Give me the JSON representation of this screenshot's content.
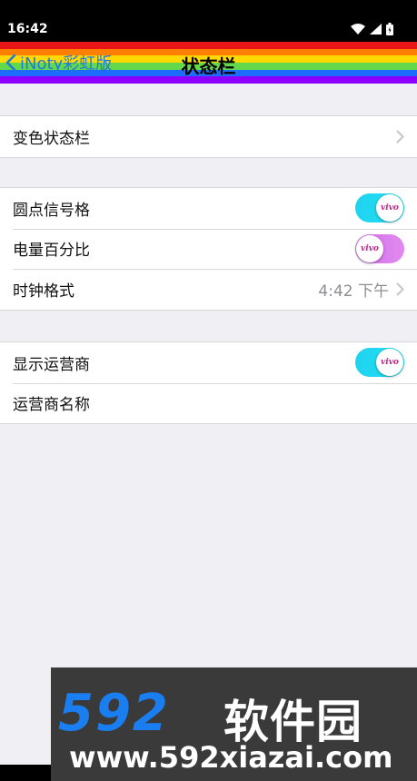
{
  "status_bar": {
    "time": "16:42",
    "icons": [
      "wifi-icon",
      "signal-icon",
      "battery-icon"
    ]
  },
  "nav": {
    "back_label": "iNoty彩虹版",
    "title": "状态栏",
    "rainbow_colors": [
      "#e81416",
      "#ff7f00",
      "#ffd800",
      "#63d84b",
      "#1e6bff",
      "#8b00ff"
    ]
  },
  "groups": [
    {
      "rows": [
        {
          "label": "变色状态栏",
          "type": "chevron"
        }
      ]
    },
    {
      "rows": [
        {
          "label": "圆点信号格",
          "type": "toggle",
          "on": true,
          "knob_text": "vivo"
        },
        {
          "label": "电量百分比",
          "type": "toggle",
          "on": false,
          "knob_text": "vivo"
        },
        {
          "label": "时钟格式",
          "type": "value-chevron",
          "value": "4:42 下午"
        }
      ]
    },
    {
      "rows": [
        {
          "label": "显示运营商",
          "type": "toggle",
          "on": true,
          "knob_text": "vivo"
        },
        {
          "label": "运营商名称",
          "type": "plain"
        }
      ]
    }
  ],
  "watermark": {
    "number": "592",
    "brand": "软件园",
    "url": "www.592xiazai.com"
  },
  "colors": {
    "accent": "#1f7ae0",
    "toggle_on": "#1fd3ef",
    "toggle_off": "#d36fe8",
    "background": "#efeff4"
  }
}
